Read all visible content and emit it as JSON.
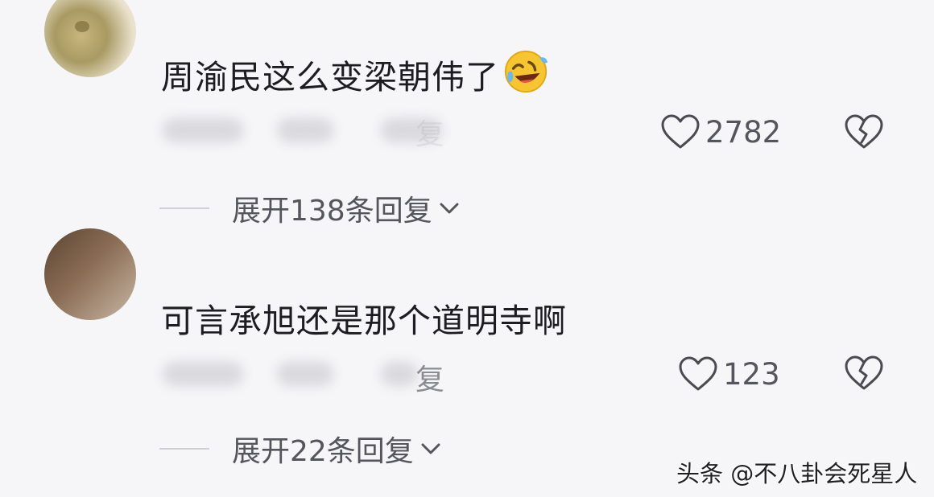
{
  "comments": [
    {
      "text": "周渝民这么变梁朝伟了",
      "emoji": "rolling-on-floor-laughing-emoji",
      "reply_label": "复",
      "likes": "2782",
      "expand_label": "展开138条回复"
    },
    {
      "text": "可言承旭还是那个道明寺啊",
      "reply_label": "复",
      "likes": "123",
      "expand_label": "展开22条回复"
    }
  ],
  "watermark": "头条 @不八卦会死星人",
  "icons": {
    "like": "heart-outline-icon",
    "dislike": "broken-heart-icon",
    "expand": "chevron-down-icon"
  },
  "colors": {
    "background": "#f6f6f8",
    "text": "#1c1c22",
    "secondary_text": "#55555d",
    "icon": "#4a4a52"
  }
}
